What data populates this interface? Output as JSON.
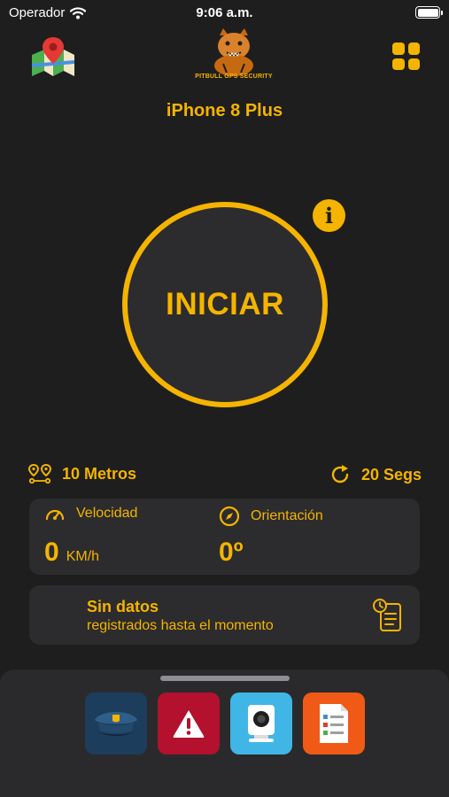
{
  "status_bar": {
    "carrier": "Operador",
    "time": "9:06 a.m."
  },
  "header": {
    "logo_text": "PITBULL GPS SECURITY",
    "device_name": "iPhone 8 Plus"
  },
  "main": {
    "start_label": "INICIAR"
  },
  "settings": {
    "distance": "10 Metros",
    "interval": "20 Segs"
  },
  "stats": {
    "speed_label": "Velocidad",
    "speed_value": "0",
    "speed_unit": "KM/h",
    "orientation_label": "Orientación",
    "orientation_value": "0º"
  },
  "history": {
    "title": "Sin datos",
    "subtitle": "registrados hasta el momento"
  },
  "dock": {
    "items": [
      {
        "icon": "police-cap-icon",
        "bg": "#1d3d5c"
      },
      {
        "icon": "alert-triangle-icon",
        "bg": "#b3112e"
      },
      {
        "icon": "camera-icon",
        "bg": "#3fb6e6"
      },
      {
        "icon": "checklist-icon",
        "bg": "#f05a16"
      }
    ]
  },
  "colors": {
    "accent": "#f5b400",
    "background": "#1e1e1e",
    "card": "#2c2c2e"
  }
}
